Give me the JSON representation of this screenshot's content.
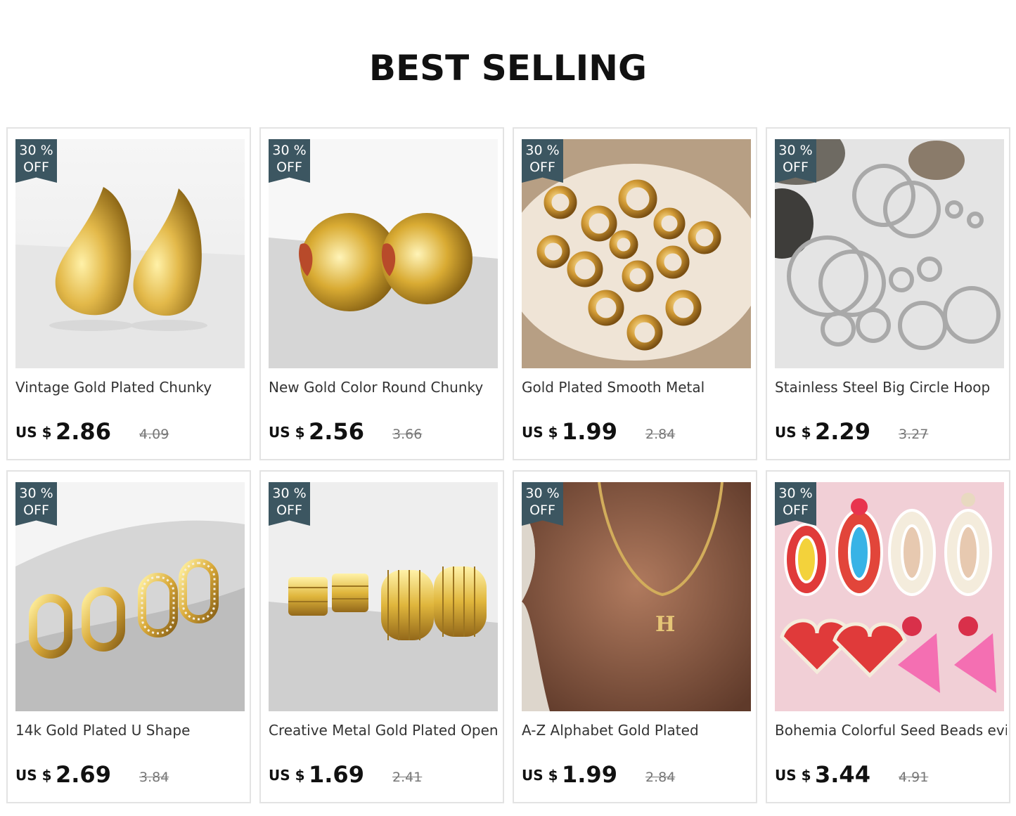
{
  "section_title": "BEST SELLING",
  "colors": {
    "badge_bg": "#3c5661",
    "card_border": "#e3e3e3"
  },
  "products": [
    {
      "badge_line1": "30 %",
      "badge_line2": "OFF",
      "name": "Vintage Gold Plated Chunky",
      "currency": "US $",
      "price": "2.86",
      "old_price": "4.09",
      "image": "gold-teardrop-earrings"
    },
    {
      "badge_line1": "30 %",
      "badge_line2": "OFF",
      "name": "New Gold Color Round Chunky",
      "currency": "US $",
      "price": "2.56",
      "old_price": "3.66",
      "image": "gold-round-chunky-earrings"
    },
    {
      "badge_line1": "30 %",
      "badge_line2": "OFF",
      "name": "Gold Plated Smooth Metal",
      "currency": "US $",
      "price": "1.99",
      "old_price": "2.84",
      "image": "gold-hoops-on-plate"
    },
    {
      "badge_line1": "30 %",
      "badge_line2": "OFF",
      "name": "Stainless Steel Big Circle Hoop",
      "currency": "US $",
      "price": "2.29",
      "old_price": "3.27",
      "image": "silver-hoop-set"
    },
    {
      "badge_line1": "30 %",
      "badge_line2": "OFF",
      "name": "14k Gold Plated U Shape",
      "currency": "US $",
      "price": "2.69",
      "old_price": "3.84",
      "image": "gold-u-shape-hoops"
    },
    {
      "badge_line1": "30 %",
      "badge_line2": "OFF",
      "name": "Creative Metal Gold Plated Open",
      "currency": "US $",
      "price": "1.69",
      "old_price": "2.41",
      "image": "gold-ribbed-open-hoops"
    },
    {
      "badge_line1": "30 %",
      "badge_line2": "OFF",
      "name": "A-Z Alphabet Gold Plated",
      "currency": "US $",
      "price": "1.99",
      "old_price": "2.84",
      "image": "letter-necklace"
    },
    {
      "badge_line1": "30 %",
      "badge_line2": "OFF",
      "name": "Bohemia Colorful Seed Beads evil",
      "currency": "US $",
      "price": "3.44",
      "old_price": "4.91",
      "image": "beaded-earrings"
    }
  ]
}
